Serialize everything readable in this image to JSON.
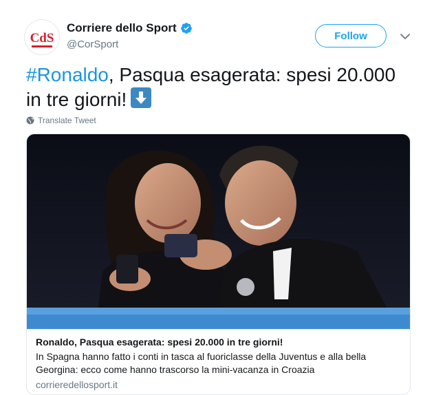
{
  "header": {
    "avatar_text": "CdS",
    "display_name": "Corriere dello Sport",
    "handle": "@CorSport",
    "follow_label": "Follow"
  },
  "tweet": {
    "hashtag": "#Ronaldo",
    "text": ", Pasqua esagerata: spesi 20.000 in tre giorni!",
    "emoji": "down-arrow-emoji",
    "translate_label": "Translate Tweet"
  },
  "card": {
    "image": "photo-couple-looking-at-phone",
    "title": "Ronaldo, Pasqua esagerata: spesi 20.000 in tre giorni!",
    "description": "In Spagna hanno fatto i conti in tasca al fuoriclasse della Juventus e alla bella Georgina: ecco come hanno trascorso la mini-vacanza in Croazia",
    "domain": "corrieredellosport.it"
  },
  "colors": {
    "brand_blue": "#1da1f2",
    "hashtag_blue": "#1b95e0",
    "logo_red": "#d6202a",
    "text_primary": "#14171a",
    "text_secondary": "#657786"
  }
}
